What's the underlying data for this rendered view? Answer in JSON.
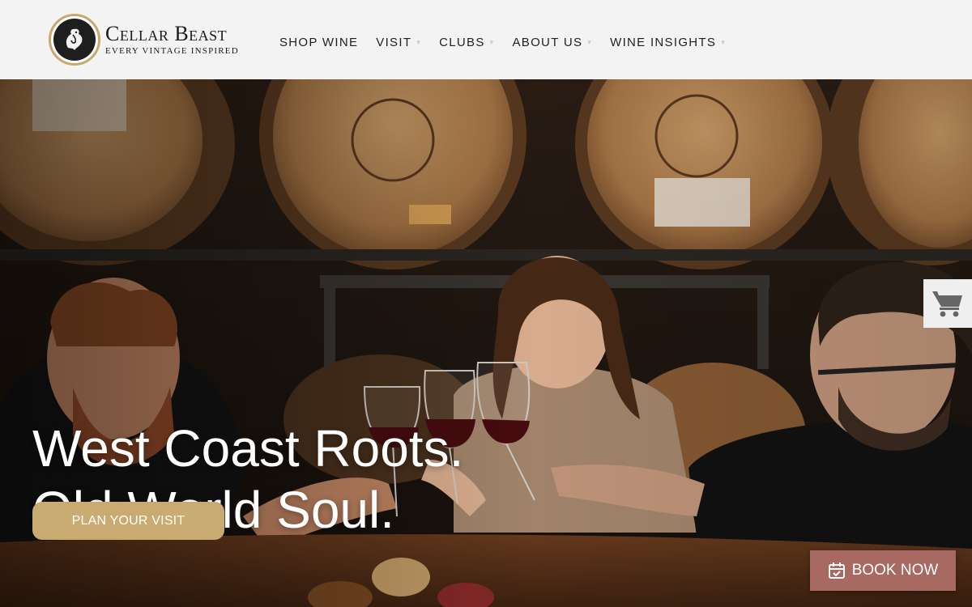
{
  "brand": {
    "name": "Cellar Beast",
    "tagline": "EVERY VINTAGE INSPIRED",
    "logo_icon": "beast-crest-icon",
    "accent_color": "#c9ab71"
  },
  "nav": {
    "items": [
      {
        "label": "SHOP WINE",
        "has_dropdown": false
      },
      {
        "label": "VISIT",
        "has_dropdown": true
      },
      {
        "label": "CLUBS",
        "has_dropdown": true
      },
      {
        "label": "ABOUT US",
        "has_dropdown": true
      },
      {
        "label": "WINE INSIGHTS",
        "has_dropdown": true
      }
    ],
    "caret_glyph": "▾"
  },
  "hero": {
    "headline_line1": "West Coast Roots.",
    "headline_line2": "Old World Soul.",
    "cta_label": "PLAN YOUR VISIT"
  },
  "cart": {
    "icon": "shopping-cart-icon"
  },
  "booking": {
    "label": "BOOK NOW",
    "icon": "calendar-check-icon",
    "color": "#a86963"
  }
}
